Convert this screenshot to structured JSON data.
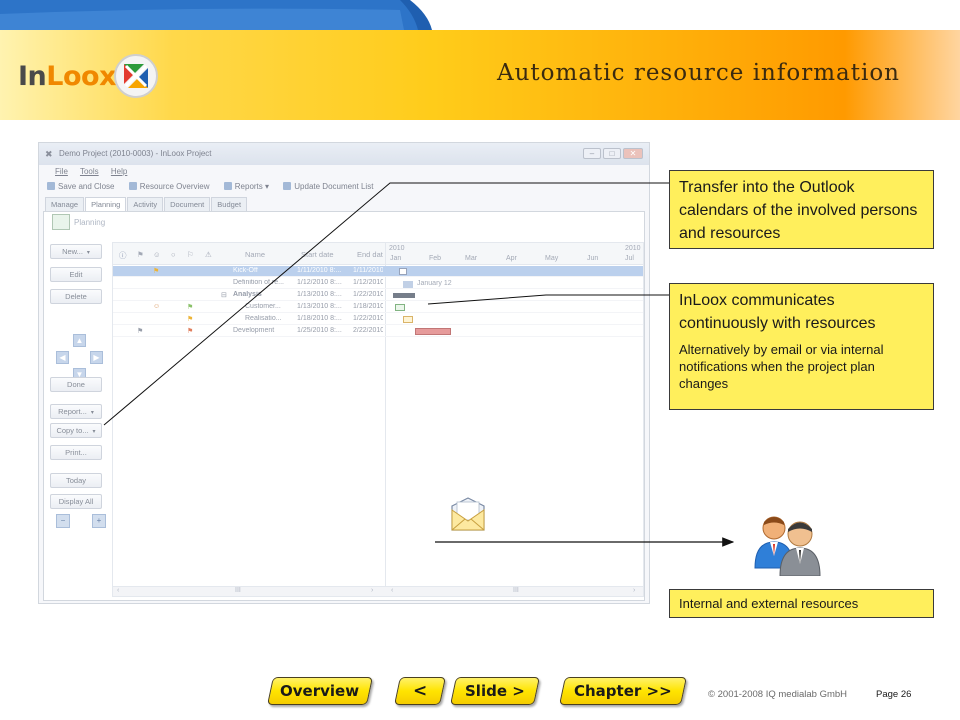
{
  "header": {
    "slide_title": "Automatic resource information",
    "logo": {
      "text_prefix": "In",
      "text_accent": "Loox",
      "mark": "inloox-x-logo"
    }
  },
  "app_window": {
    "title": "Demo Project (2010-0003) - InLoox Project",
    "menu": [
      "File",
      "Tools",
      "Help"
    ],
    "toolbar": [
      "Save and Close",
      "Resource Overview",
      "Reports",
      "Update Document List"
    ],
    "tabs": [
      "Manage",
      "Planning",
      "Activity",
      "Document",
      "Budget"
    ],
    "active_tab": "Planning",
    "section_label": "Planning",
    "side_buttons": [
      "New...",
      "Edit",
      "Delete",
      "Done",
      "Report...",
      "Copy to...",
      "Print...",
      "Today",
      "Display All"
    ],
    "grid_headers": {
      "name": "Name",
      "start": "Start date",
      "end": "End dat"
    },
    "timeline": {
      "years": [
        "2010",
        "2010"
      ],
      "months": [
        "Jan",
        "Feb",
        "Mar",
        "Apr",
        "May",
        "Jun",
        "Jul"
      ]
    },
    "rows": [
      {
        "name": "Kick-Off",
        "start": "1/11/2010 8:...",
        "end": "1/11/2010"
      },
      {
        "name": "Definition of re...",
        "start": "1/12/2010 8:...",
        "end": "1/12/2010"
      },
      {
        "name": "Analysis",
        "start": "1/13/2010 8:...",
        "end": "1/22/2010"
      },
      {
        "name": "Customer...",
        "start": "1/13/2010 8:...",
        "end": "1/18/2010"
      },
      {
        "name": "Realisatio...",
        "start": "1/18/2010 8:...",
        "end": "1/22/2010"
      },
      {
        "name": "Development",
        "start": "1/25/2010 8:...",
        "end": "2/22/2010"
      }
    ],
    "milestone_label": "January 12",
    "scroll_marks": [
      "‹",
      "III",
      "›",
      "‹",
      "III",
      "›"
    ]
  },
  "callouts": {
    "outlook": "Transfer into the Outlook calendars of the involved persons and resources",
    "communicates_headline": "InLoox communicates continuously with resources",
    "communicates_detail": "Alternatively by email or via internal notifications when the project plan changes",
    "resources": "Internal and external resources"
  },
  "icons": {
    "email": "email-envelope-icon",
    "people": "people-resources-icon"
  },
  "navigation": {
    "overview": "Overview",
    "previous": "<",
    "slide": "Slide >",
    "chapter": "Chapter >>"
  },
  "footer": {
    "copyright": "© 2001-2008 IQ medialab GmbH",
    "page": "Page 26"
  },
  "colors": {
    "callout_fill": "#ffef5c",
    "header_yellow": "#ffcc1a",
    "header_orange": "#ff9a00",
    "nav_button_yellow": "#ffe400",
    "brand_blue": "#1f5fb0"
  }
}
